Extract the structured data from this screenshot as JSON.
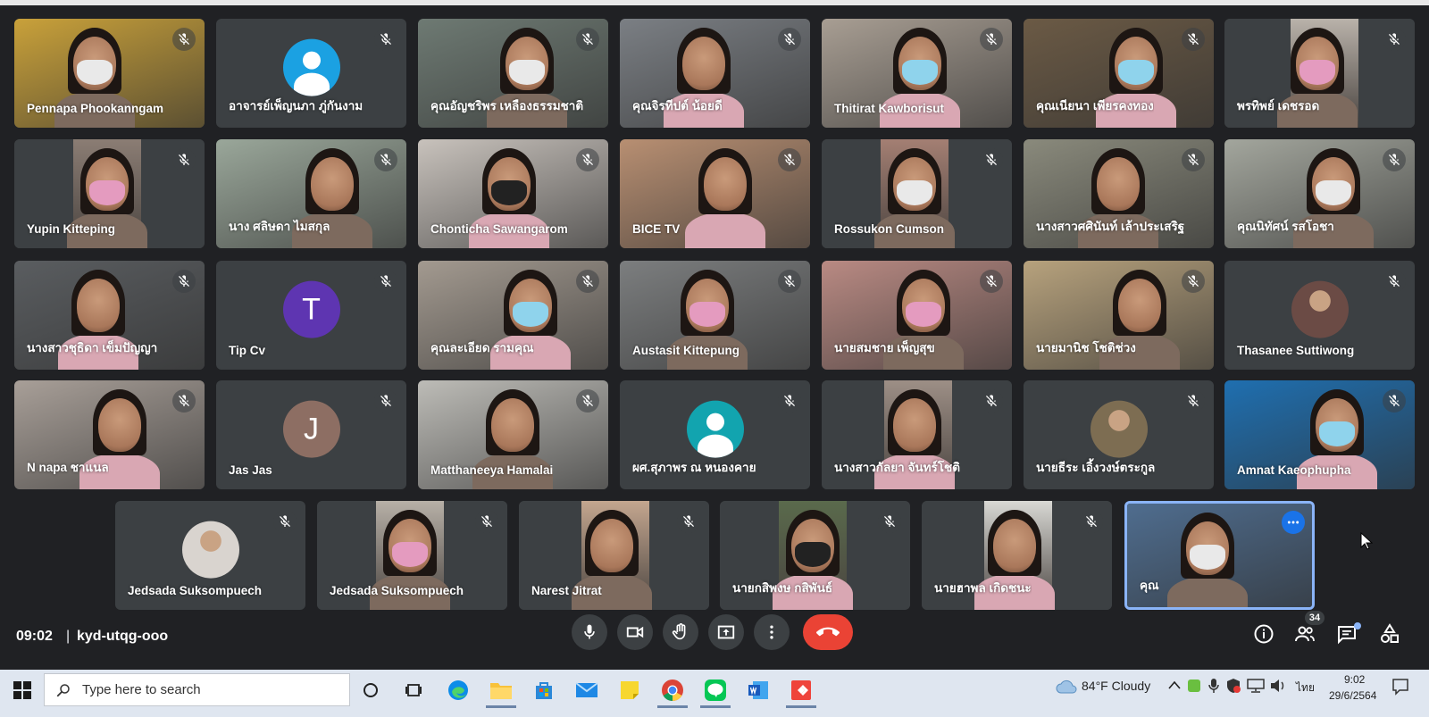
{
  "meeting": {
    "time": "09:02",
    "separator": "|",
    "code": "kyd-utqg-ooo",
    "participant_count": "34"
  },
  "participants": [
    {
      "name": "Pennapa Phookanngam",
      "kind": "video",
      "bg": "#c9a13a"
    },
    {
      "name": "อาจารย์เพ็ญนภา ภู่กันงาม",
      "kind": "placeholder",
      "avatar_color": "#1ba1e2"
    },
    {
      "name": "คุณอัญชริพร เหลืองธรรมชาติ",
      "kind": "video",
      "bg": "#6e7a73"
    },
    {
      "name": "คุณจิรทีปต์ น้อยดี",
      "kind": "video",
      "bg": "#7b7f84"
    },
    {
      "name": "Thitirat Kawborisut",
      "kind": "video",
      "bg": "#a89e93"
    },
    {
      "name": "คุณเนียนา เพียรคงทอง",
      "kind": "video",
      "bg": "#6b5a45"
    },
    {
      "name": "พรทิพย์ เดชรอด",
      "kind": "video_strip",
      "bg": "#b9b2aa"
    },
    {
      "name": "Yupin Kitteping",
      "kind": "video_strip",
      "bg": "#8b7d74"
    },
    {
      "name": "นาง ศลิษดา ไมสกุล",
      "kind": "video",
      "bg": "#9aa79a"
    },
    {
      "name": "Chonticha Sawangarom",
      "kind": "video",
      "bg": "#c8c2bc"
    },
    {
      "name": "BICE TV",
      "kind": "video",
      "bg": "#b88f72"
    },
    {
      "name": "Rossukon Cumson",
      "kind": "video_strip",
      "bg": "#a47f73"
    },
    {
      "name": "นางสาวศศินันท์ เล้าประเสริฐ",
      "kind": "video",
      "bg": "#8a8a7c"
    },
    {
      "name": "คุณนิทัศน์ รสโอชา",
      "kind": "video",
      "bg": "#a3a69d"
    },
    {
      "name": "นางสาวชุธิดา เข็มปัญญา",
      "kind": "video",
      "bg": "#5a5d60"
    },
    {
      "name": "Tip Cv",
      "kind": "letter",
      "letter": "T",
      "avatar_color": "#5e35b1"
    },
    {
      "name": "คุณละเอียด รามคุณ",
      "kind": "video",
      "bg": "#a39a90"
    },
    {
      "name": "Austasit Kittepung",
      "kind": "video",
      "bg": "#7c7e7f"
    },
    {
      "name": "นายสมชาย เพ็ญสุข",
      "kind": "video",
      "bg": "#b98a83"
    },
    {
      "name": "นายมานิช โชติช่วง",
      "kind": "video",
      "bg": "#b7a27d"
    },
    {
      "name": "Thasanee Suttiwong",
      "kind": "photo",
      "avatar_color": "#6b4b45"
    },
    {
      "name": "N napa ชาแนล",
      "kind": "video",
      "bg": "#a89f98"
    },
    {
      "name": "Jas Jas",
      "kind": "letter",
      "letter": "J",
      "avatar_color": "#8d6e63"
    },
    {
      "name": "Matthaneeya Hamalai",
      "kind": "video",
      "bg": "#bdbcb7"
    },
    {
      "name": "ผศ.สุภาพร ณ หนองคาย",
      "kind": "placeholder",
      "avatar_color": "#12a4af"
    },
    {
      "name": "นางสาวกัลยา จันทร์โชติ",
      "kind": "video_strip",
      "bg": "#9d8f86"
    },
    {
      "name": "นายธีระ เอิ้งวงษ์ตระกูล",
      "kind": "photo",
      "avatar_color": "#7d6d52"
    },
    {
      "name": "Amnat Kaeophupha",
      "kind": "video",
      "bg": "#1f6fb0"
    },
    {
      "name": "Jedsada Suksompuech",
      "kind": "photo",
      "avatar_color": "#d9d4cf"
    },
    {
      "name": "Jedsada Suksompuech",
      "kind": "video_strip",
      "bg": "#b7b0a7"
    },
    {
      "name": "Narest Jitrat",
      "kind": "video_strip",
      "bg": "#c4a68f"
    },
    {
      "name": "นายกสิพงษ กสิพันธ์",
      "kind": "video_strip",
      "bg": "#5a6a4c"
    },
    {
      "name": "นายฮาพล เกิดชนะ",
      "kind": "video_strip",
      "bg": "#d8d8d4"
    },
    {
      "name": "คุณ",
      "kind": "self",
      "bg": "#4f6d8f"
    }
  ],
  "taskbar": {
    "search_placeholder": "Type here to search",
    "weather": "84°F  Cloudy",
    "lang": "ไทย",
    "time": "9:02",
    "date": "29/6/2564"
  },
  "colors": {
    "background": "#202124",
    "end_call": "#ea4335",
    "self_border": "#8ab4f8"
  }
}
